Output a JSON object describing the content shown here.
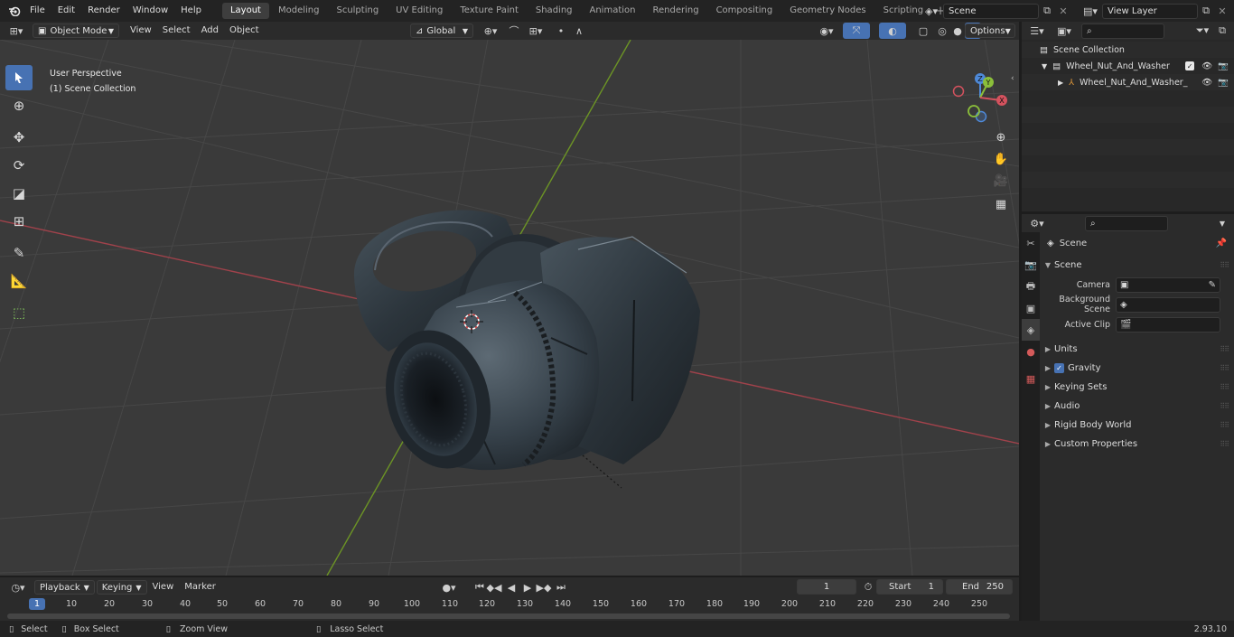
{
  "top_menu": [
    "File",
    "Edit",
    "Render",
    "Window",
    "Help"
  ],
  "workspaces": [
    "Layout",
    "Modeling",
    "Sculpting",
    "UV Editing",
    "Texture Paint",
    "Shading",
    "Animation",
    "Rendering",
    "Compositing",
    "Geometry Nodes",
    "Scripting"
  ],
  "active_workspace": "Layout",
  "scene_field": "Scene",
  "view_layer_field": "View Layer",
  "viewport": {
    "mode": "Object Mode",
    "menus": [
      "View",
      "Select",
      "Add",
      "Object"
    ],
    "transform_orientation": "Global",
    "options_label": "Options",
    "perspective_label": "User Perspective",
    "collection_label": "(1) Scene Collection",
    "gizmo_labels": {
      "x": "X",
      "y": "Y",
      "z": "Z"
    }
  },
  "outliner": {
    "root": "Scene Collection",
    "collection": "Wheel_Nut_And_Washer",
    "object": "Wheel_Nut_And_Washer_"
  },
  "properties": {
    "context_title": "Scene",
    "section_title": "Scene",
    "camera_label": "Camera",
    "background_scene_label": "Background Scene",
    "active_clip_label": "Active Clip",
    "panels": [
      "Units",
      "Gravity",
      "Keying Sets",
      "Audio",
      "Rigid Body World",
      "Custom Properties"
    ]
  },
  "timeline": {
    "menus": [
      "Playback",
      "Keying",
      "View",
      "Marker"
    ],
    "current_frame": "1",
    "start_label": "Start",
    "start_value": "1",
    "end_label": "End",
    "end_value": "250",
    "ruler": [
      "1",
      "10",
      "20",
      "30",
      "40",
      "50",
      "60",
      "70",
      "80",
      "90",
      "100",
      "110",
      "120",
      "130",
      "140",
      "150",
      "160",
      "170",
      "180",
      "190",
      "200",
      "210",
      "220",
      "230",
      "240",
      "250"
    ]
  },
  "statusbar": {
    "select": "Select",
    "box_select": "Box Select",
    "zoom_view": "Zoom View",
    "lasso_select": "Lasso Select",
    "version": "2.93.10"
  },
  "colors": {
    "accent": "#4772b3",
    "x_axis": "#d4525e",
    "y_axis": "#8bbf3a",
    "z_axis": "#4e89d8"
  }
}
